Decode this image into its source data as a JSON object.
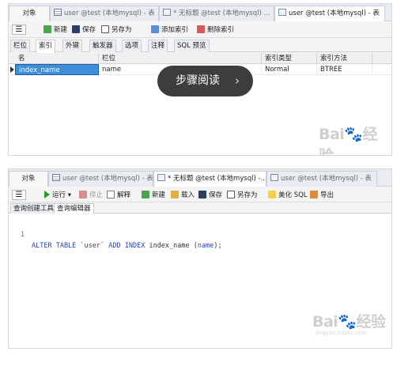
{
  "panel1": {
    "tabs": [
      {
        "label": "对象",
        "icon": ""
      },
      {
        "label": "user @test (本地mysql) - 表",
        "icon": "table-icon"
      },
      {
        "label": "* 无标题 @test (本地mysql) ...",
        "icon": "query-icon"
      },
      {
        "label": "user @test (本地mysql) - 表",
        "icon": "design-table-icon"
      }
    ],
    "toolbar": {
      "new": "新建",
      "save": "保存",
      "save_as": "另存为",
      "add_index": "添加索引",
      "delete_index": "删除索引"
    },
    "subtabs": [
      "栏位",
      "索引",
      "外键",
      "触发器",
      "选项",
      "注释",
      "SQL 预览"
    ],
    "columns": [
      "名",
      "栏位",
      "索引类型",
      "索引方法"
    ],
    "rows": [
      {
        "name": "index_name",
        "field": "name",
        "type": "Normal",
        "method": "BTREE"
      }
    ],
    "overlay": {
      "label": "步骤阅读",
      "chevron": "›"
    }
  },
  "panel2": {
    "tabs": [
      {
        "label": "对象",
        "icon": ""
      },
      {
        "label": "user @test (本地mysql) - 表",
        "icon": "table-icon"
      },
      {
        "label": "* 无标题 @test (本地mysql) -...",
        "icon": "query-icon"
      },
      {
        "label": "user @test (本地mysql) - 表",
        "icon": "design-table-icon"
      }
    ],
    "toolbar": {
      "run": "运行",
      "stop": "停止",
      "explain": "解释",
      "new": "新建",
      "load": "载入",
      "save": "保存",
      "save_as": "另存为",
      "beautify": "美化 SQL",
      "export": "导出"
    },
    "subtabs": [
      "查询创建工具",
      "查询编辑器"
    ],
    "code": {
      "line_number": "1",
      "kw1": "ALTER TABLE",
      "tbl": "`user`",
      "kw2": "ADD INDEX",
      "idx": "index_name",
      "paren_open": "(",
      "col": "name",
      "paren_close": ");"
    }
  },
  "watermark": {
    "brand": "Bai",
    "brand2": "经验",
    "url": "jingyan.baidu.com"
  },
  "colors": {
    "selection": "#3e8ed9",
    "overlay": "#282828",
    "keyword": "#2a3fbf"
  }
}
